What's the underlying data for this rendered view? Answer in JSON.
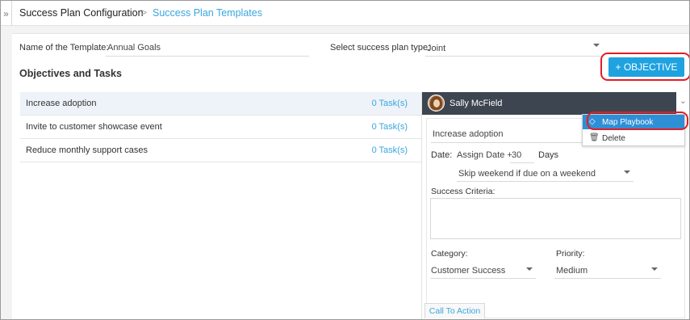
{
  "header": {
    "expand_icon": "double-chevron-right",
    "breadcrumb_root": "Success Plan Configuration",
    "breadcrumb_separator": ">",
    "breadcrumb_current": "Success Plan Templates"
  },
  "template": {
    "name_label": "Name of the Template:",
    "name_value": "Annual Goals",
    "type_label": "Select success plan type:",
    "type_value": "Joint"
  },
  "objectives": {
    "section_title": "Objectives and Tasks",
    "add_button": "+ OBJECTIVE",
    "items": [
      {
        "name": "Increase adoption",
        "tasks": "0 Task(s)",
        "selected": true
      },
      {
        "name": "Invite to customer showcase event",
        "tasks": "0 Task(s)",
        "selected": false
      },
      {
        "name": "Reduce monthly support cases",
        "tasks": "0 Task(s)",
        "selected": false
      }
    ]
  },
  "detail": {
    "owner": "Sally McField",
    "objective_name": "Increase adoption",
    "date_label": "Date:",
    "date_prefix": "Assign Date +",
    "date_offset": "30",
    "date_unit": "Days",
    "weekend_option": "Skip weekend if due on a weekend",
    "success_criteria_label": "Success Criteria:",
    "category_label": "Category:",
    "category_value": "Customer Success",
    "priority_label": "Priority:",
    "priority_value": "Medium",
    "cta_tab": "Call To Action"
  },
  "menu": {
    "items": [
      {
        "label": "Map Playbook",
        "icon": "playbook-icon"
      },
      {
        "label": "Delete",
        "icon": "trash-icon"
      }
    ]
  },
  "colors": {
    "accent": "#1ea2e0",
    "link": "#3aa6dd",
    "highlight_ring": "#e51c24",
    "detail_header": "#3c4550",
    "menu_highlight": "#2e8fd6"
  }
}
